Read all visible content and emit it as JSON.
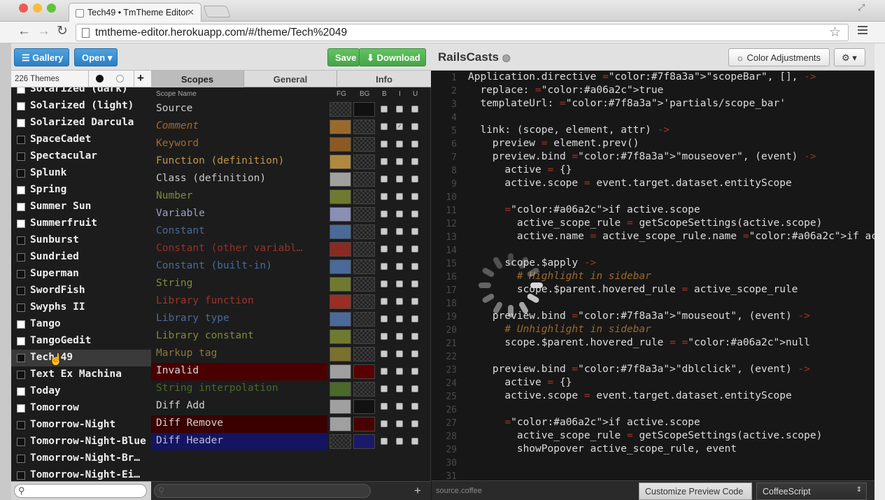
{
  "browser": {
    "tab_title": "Tech49 • TmTheme Editor",
    "url": "tmtheme-editor.herokuapp.com/#/theme/Tech%2049"
  },
  "appbar": {
    "gallery_label": "Gallery",
    "open_label": "Open",
    "save_label": "Save",
    "download_label": "Download",
    "theme_name": "RailsCasts",
    "color_adjustments_label": "Color Adjustments"
  },
  "sidebar": {
    "count_label": "226 Themes",
    "themes": [
      {
        "name": "Solarized (dark)",
        "dark": false
      },
      {
        "name": "Solarized (light)",
        "dark": false
      },
      {
        "name": "Solarized Darcula",
        "dark": false
      },
      {
        "name": "SpaceCadet",
        "dark": true
      },
      {
        "name": "Spectacular",
        "dark": true
      },
      {
        "name": "Splunk",
        "dark": true
      },
      {
        "name": "Spring",
        "dark": false
      },
      {
        "name": "Summer Sun",
        "dark": false
      },
      {
        "name": "Summerfruit",
        "dark": false
      },
      {
        "name": "Sunburst",
        "dark": true
      },
      {
        "name": "Sundried",
        "dark": true
      },
      {
        "name": "Superman",
        "dark": true
      },
      {
        "name": "SwordFish",
        "dark": true
      },
      {
        "name": "Swyphs II",
        "dark": true
      },
      {
        "name": "Tango",
        "dark": false
      },
      {
        "name": "TangoGedit",
        "dark": false
      },
      {
        "name": "Tech 49",
        "dark": true,
        "selected": true
      },
      {
        "name": "Text Ex Machina",
        "dark": true
      },
      {
        "name": "Today",
        "dark": false
      },
      {
        "name": "Tomorrow",
        "dark": false
      },
      {
        "name": "Tomorrow-Night",
        "dark": true
      },
      {
        "name": "Tomorrow-Night-Blue",
        "dark": true
      },
      {
        "name": "Tomorrow-Night-Br…",
        "dark": true
      },
      {
        "name": "Tomorrow-Night-Ei…",
        "dark": true
      }
    ]
  },
  "scopes_panel": {
    "tabs": [
      "Scopes",
      "General",
      "Info"
    ],
    "col_name": "Scope Name",
    "col_fg": "FG",
    "col_bg": "BG",
    "col_b": "B",
    "col_i": "I",
    "col_u": "U",
    "rows": [
      {
        "name": "Source",
        "color": "#d0d0d0",
        "italic": false,
        "fg": "checker",
        "bg": "#111111",
        "rowbg": "",
        "i": false
      },
      {
        "name": "Comment",
        "color": "#a0682a",
        "italic": true,
        "fg": "#9a6a2c",
        "bg": "checker",
        "rowbg": "",
        "i": true
      },
      {
        "name": "Keyword",
        "color": "#a06a2c",
        "italic": false,
        "fg": "#8a5a22",
        "bg": "checker",
        "rowbg": "",
        "i": false
      },
      {
        "name": "Function (definition)",
        "color": "#c0964a",
        "italic": false,
        "fg": "#b0893e",
        "bg": "checker",
        "rowbg": "",
        "i": false
      },
      {
        "name": "Class (definition)",
        "color": "#c8c8c8",
        "italic": false,
        "fg": "#a0a0a0",
        "bg": "checker",
        "rowbg": "",
        "i": false
      },
      {
        "name": "Number",
        "color": "#7f8a3a",
        "italic": false,
        "fg": "#6f7a30",
        "bg": "checker",
        "rowbg": "",
        "i": false
      },
      {
        "name": "Variable",
        "color": "#9aa0c8",
        "italic": false,
        "fg": "#8a8fb4",
        "bg": "checker",
        "rowbg": "",
        "i": false
      },
      {
        "name": "Constant",
        "color": "#4a6a9a",
        "italic": false,
        "fg": "#4a6a9a",
        "bg": "checker",
        "rowbg": "",
        "i": false
      },
      {
        "name": "Constant (other variabl…",
        "color": "#9a3026",
        "italic": false,
        "fg": "#8a2a22",
        "bg": "checker",
        "rowbg": "",
        "i": false
      },
      {
        "name": "Constant (built-in)",
        "color": "#4a6a9a",
        "italic": false,
        "fg": "#4a6a9a",
        "bg": "checker",
        "rowbg": "",
        "i": false
      },
      {
        "name": "String",
        "color": "#7f8a3a",
        "italic": false,
        "fg": "#6f7a30",
        "bg": "checker",
        "rowbg": "",
        "i": false
      },
      {
        "name": "Library function",
        "color": "#a03428",
        "italic": false,
        "fg": "#9a2e24",
        "bg": "checker",
        "rowbg": "",
        "i": false
      },
      {
        "name": "Library type",
        "color": "#4a6a9a",
        "italic": false,
        "fg": "#4a6a9a",
        "bg": "checker",
        "rowbg": "",
        "i": false
      },
      {
        "name": "Library constant",
        "color": "#7f8a3a",
        "italic": false,
        "fg": "#6f7a30",
        "bg": "checker",
        "rowbg": "",
        "i": false
      },
      {
        "name": "Markup tag",
        "color": "#8a7a3a",
        "italic": false,
        "fg": "#7a7030",
        "bg": "checker",
        "rowbg": "",
        "i": false
      },
      {
        "name": "Invalid",
        "color": "#d8d8d8",
        "italic": false,
        "fg": "#a0a0a0",
        "bg": "#5a0000",
        "rowbg": "#4a0000",
        "i": false
      },
      {
        "name": "String interpolation",
        "color": "#4a6a2a",
        "italic": false,
        "fg": "#4a6a2a",
        "bg": "checker",
        "rowbg": "",
        "i": false
      },
      {
        "name": "Diff Add",
        "color": "#d0d0d0",
        "italic": false,
        "fg": "#a0a0a0",
        "bg": "#111111",
        "rowbg": "",
        "i": false
      },
      {
        "name": "Diff Remove",
        "color": "#d0d0d0",
        "italic": false,
        "fg": "#a0a0a0",
        "bg": "#4a0000",
        "rowbg": "#3a0000",
        "i": false
      },
      {
        "name": "Diff Header",
        "color": "#b8bedc",
        "italic": false,
        "fg": "checker",
        "bg": "#1a1a6a",
        "rowbg": "#141460",
        "i": false
      }
    ]
  },
  "editor": {
    "lines": [
      "Application.directive \"scopeBar\", [], ->",
      "  replace: true",
      "  templateUrl: 'partials/scope_bar'",
      "",
      "  link: (scope, element, attr) ->",
      "    preview = element.prev()",
      "    preview.bind \"mouseover\", (event) ->",
      "      active = {}",
      "      active.scope = event.target.dataset.entityScope",
      "",
      "      if active.scope",
      "        active_scope_rule = getScopeSettings(active.scope)",
      "        active.name = active_scope_rule.name if active_scope_rule",
      "",
      "      scope.$apply ->",
      "        # Highlight in sidebar",
      "        scope.$parent.hovered_rule = active_scope_rule",
      "",
      "    preview.bind \"mouseout\", (event) ->",
      "      # Unhighlight in sidebar",
      "      scope.$parent.hovered_rule = null",
      "",
      "    preview.bind \"dblclick\", (event) ->",
      "      active = {}",
      "      active.scope = event.target.dataset.entityScope",
      "",
      "      if active.scope",
      "        active_scope_rule = getScopeSettings(active.scope)",
      "        showPopover active_scope_rule, event",
      "",
      ""
    ],
    "line_numbers": [
      "1",
      "2",
      "3",
      "4",
      "5",
      "6",
      "7",
      "8",
      "9",
      "10",
      "11",
      "12",
      "13",
      "14",
      "15",
      "16",
      "17",
      "18",
      "19",
      "20",
      "21",
      "22",
      "23",
      "24",
      "25",
      "26",
      "27",
      "28",
      "29",
      "30",
      "31"
    ]
  },
  "statusbar": {
    "source_label": "source.coffee",
    "customize_label": "Customize Preview Code",
    "language": "CoffeeScript"
  },
  "colors": {
    "accent_blue": "#2a7fc3",
    "accent_green": "#47a447",
    "editor_bg": "#171717"
  }
}
